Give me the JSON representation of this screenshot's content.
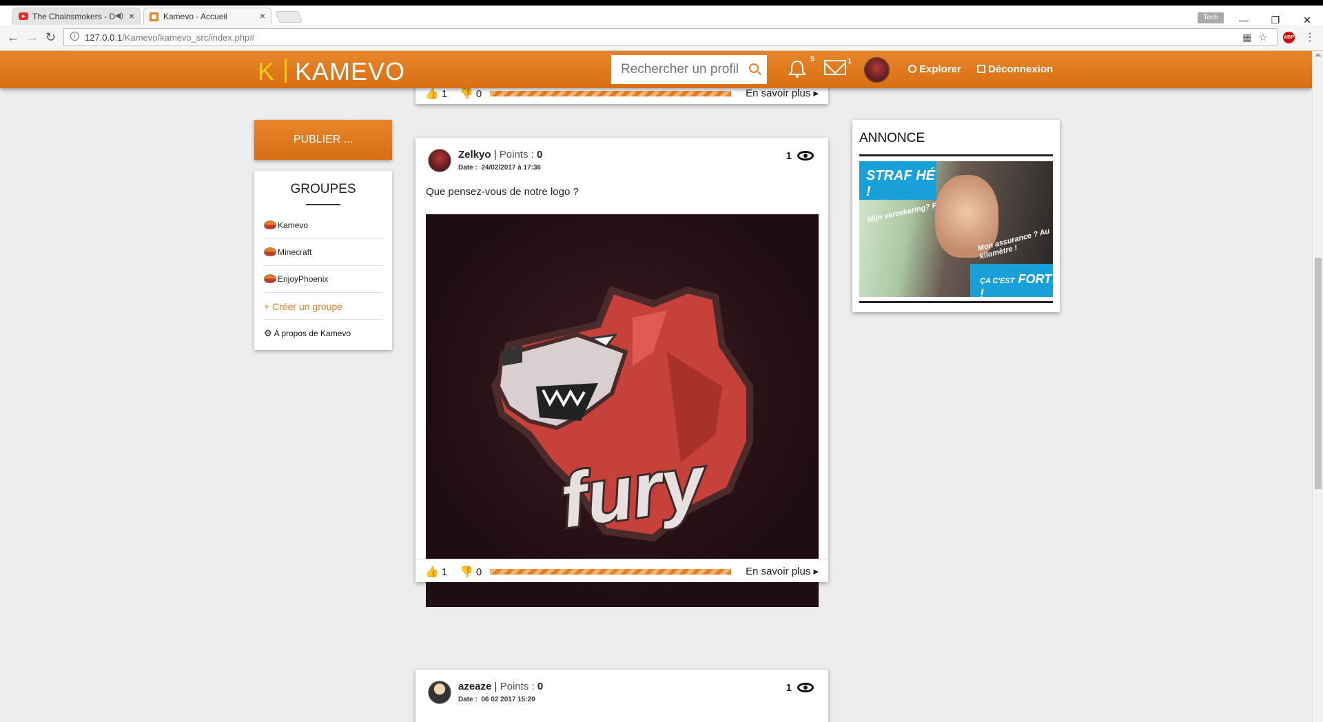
{
  "browser": {
    "tabs": [
      {
        "title": "The Chainsmokers - D"
      },
      {
        "title": "Kamevo - Accueil"
      }
    ],
    "profile": "Tech",
    "url_host": "127.0.0.1",
    "url_path": "/Kamevo/kamevo_src/index.php#",
    "abp": "ABP"
  },
  "header": {
    "logo_letter": "K",
    "logo_name": "KAMEVO",
    "search_placeholder": "Rechercher un profil",
    "notif_count": "5",
    "message_count": "1",
    "explore": "Explorer",
    "logout": "Déconnexion"
  },
  "left": {
    "publish": "PUBLIER ...",
    "groups_title": "GROUPES",
    "groups": [
      "Kamevo",
      "Minecraft",
      "EnjoyPhoenix"
    ],
    "create_group": "+ Créer un groupe",
    "about": "A propos de Kamevo"
  },
  "posts": [
    {
      "likes": "1",
      "dislikes": "0",
      "more": "En savoir plus"
    },
    {
      "author": "Zelkyo",
      "points_label": "Points :",
      "points": "0",
      "date_label": "Date :",
      "date": "24/02/2017 à 17:36",
      "views": "1",
      "text": "Que pensez-vous de notre logo ?",
      "image_text": "fury",
      "likes": "1",
      "dislikes": "0",
      "more": "En savoir plus"
    },
    {
      "author": "azeaze",
      "points_label": "Points :",
      "points": "0",
      "date_label": "Date :",
      "date": "06 02 2017 15:20",
      "views": "1"
    }
  ],
  "annonce": {
    "title": "ANNONCE",
    "ad_tag1": "STRAF HÉ !",
    "ad_sub1": "Mijn verzekering? Per kilometer!",
    "ad_sub2": "Mon assurance ? Au kilomètre !",
    "ad_tag2_a": "ÇA C'EST",
    "ad_tag2_b": "FORT !"
  }
}
